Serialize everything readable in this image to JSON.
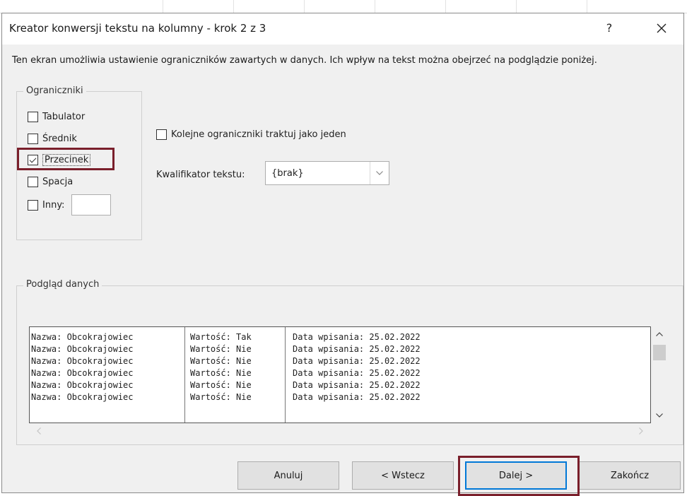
{
  "window": {
    "title": "Kreator konwersji tekstu na kolumny - krok 2 z 3",
    "help_glyph": "?",
    "close_glyph": "✕"
  },
  "description": "Ten ekran umożliwia ustawienie ograniczników zawartych w danych. Ich wpływ na tekst można obejrzeć na podglądzie poniżej.",
  "delimiters": {
    "group_label": "Ograniczniki",
    "items": [
      {
        "label": "Tabulator",
        "checked": false
      },
      {
        "label": "Średnik",
        "checked": false
      },
      {
        "label": "Przecinek",
        "checked": true
      },
      {
        "label": "Spacja",
        "checked": false
      },
      {
        "label": "Inny:",
        "checked": false
      }
    ],
    "other_value": ""
  },
  "consecutive": {
    "label": "Kolejne ograniczniki traktuj jako jeden",
    "checked": false
  },
  "qualifier": {
    "label": "Kwalifikator tekstu:",
    "value": "{brak}"
  },
  "preview": {
    "label": "Podgląd danych",
    "rows": [
      [
        "Nazwa: Obcokrajowiec",
        "Wartość: Tak",
        "Data wpisania: 25.02.2022"
      ],
      [
        "Nazwa: Obcokrajowiec",
        "Wartość: Nie",
        "Data wpisania: 25.02.2022"
      ],
      [
        "Nazwa: Obcokrajowiec",
        "Wartość: Nie",
        "Data wpisania: 25.02.2022"
      ],
      [
        "Nazwa: Obcokrajowiec",
        "Wartość: Nie",
        "Data wpisania: 25.02.2022"
      ],
      [
        "Nazwa: Obcokrajowiec",
        "Wartość: Nie",
        "Data wpisania: 25.02.2022"
      ],
      [
        "Nazwa: Obcokrajowiec",
        "Wartość: Nie",
        "Data wpisania: 25.02.2022"
      ]
    ]
  },
  "buttons": {
    "cancel": "Anuluj",
    "back": "< Wstecz",
    "next": "Dalej >",
    "finish": "Zakończ"
  },
  "colors": {
    "highlight": "#7a1f2b",
    "primary_border": "#0078d7"
  }
}
